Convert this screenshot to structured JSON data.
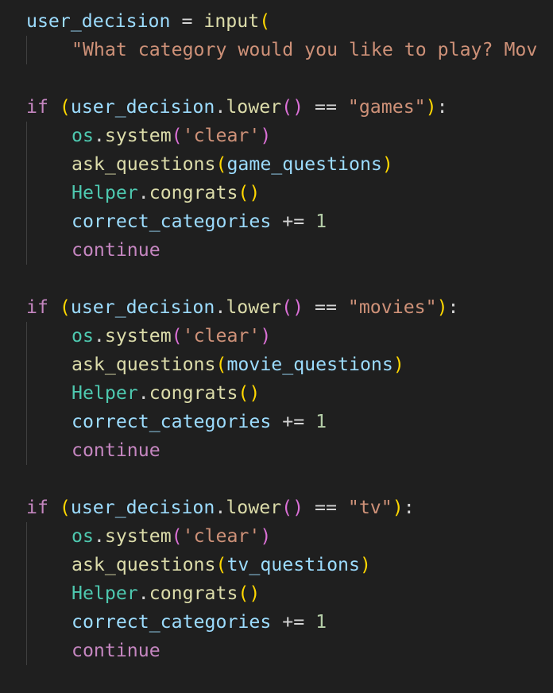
{
  "code": {
    "l1_var": "user_decision",
    "l1_op": " = ",
    "l1_fn": "input",
    "l1_paren": "(",
    "l2_str": "\"What category would you like to play? Mov",
    "block_games": {
      "if_kw": "if ",
      "open_paren": "(",
      "var": "user_decision",
      "dot": ".",
      "method": "lower",
      "call_parens": "()",
      "eq": " == ",
      "str": "\"games\"",
      "close_paren": ")",
      "colon": ":",
      "os": "os",
      "os_dot": ".",
      "system": "system",
      "sys_open": "(",
      "clear": "'clear'",
      "sys_close": ")",
      "ask": "ask_questions",
      "ask_open": "(",
      "ask_arg": "game_questions",
      "ask_close": ")",
      "helper": "Helper",
      "helper_dot": ".",
      "congrats": "congrats",
      "congrats_parens": "()",
      "correct": "correct_categories",
      "plus_eq": " += ",
      "one": "1",
      "continue": "continue"
    },
    "block_movies": {
      "if_kw": "if ",
      "open_paren": "(",
      "var": "user_decision",
      "dot": ".",
      "method": "lower",
      "call_parens": "()",
      "eq": " == ",
      "str": "\"movies\"",
      "close_paren": ")",
      "colon": ":",
      "os": "os",
      "os_dot": ".",
      "system": "system",
      "sys_open": "(",
      "clear": "'clear'",
      "sys_close": ")",
      "ask": "ask_questions",
      "ask_open": "(",
      "ask_arg": "movie_questions",
      "ask_close": ")",
      "helper": "Helper",
      "helper_dot": ".",
      "congrats": "congrats",
      "congrats_parens": "()",
      "correct": "correct_categories",
      "plus_eq": " += ",
      "one": "1",
      "continue": "continue"
    },
    "block_tv": {
      "if_kw": "if ",
      "open_paren": "(",
      "var": "user_decision",
      "dot": ".",
      "method": "lower",
      "call_parens": "()",
      "eq": " == ",
      "str": "\"tv\"",
      "close_paren": ")",
      "colon": ":",
      "os": "os",
      "os_dot": ".",
      "system": "system",
      "sys_open": "(",
      "clear": "'clear'",
      "sys_close": ")",
      "ask": "ask_questions",
      "ask_open": "(",
      "ask_arg": "tv_questions",
      "ask_close": ")",
      "helper": "Helper",
      "helper_dot": ".",
      "congrats": "congrats",
      "congrats_parens": "()",
      "correct": "correct_categories",
      "plus_eq": " += ",
      "one": "1",
      "continue": "continue"
    }
  },
  "theme": {
    "background": "#1f1f1f",
    "keyword": "#c586c0",
    "function": "#dcdcaa",
    "variable": "#9cdcfe",
    "class": "#4ec9b0",
    "string": "#ce9178",
    "number": "#b5cea8",
    "bracket_level1": "#ffd700",
    "bracket_level2": "#da70d6"
  }
}
